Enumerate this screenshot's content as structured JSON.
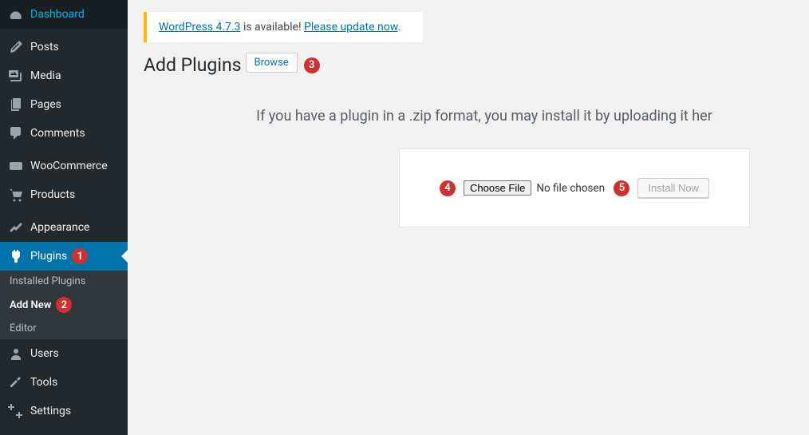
{
  "notice": {
    "version_link": "WordPress 4.7.3",
    "available_text": " is available! ",
    "update_link": "Please update now",
    "period": "."
  },
  "page": {
    "title": "Add Plugins",
    "browse_button": "Browse",
    "instructions": "If you have a plugin in a .zip format, you may install it by uploading it her",
    "choose_file": "Choose File",
    "no_file": "No file chosen",
    "install_now": "Install Now"
  },
  "badges": {
    "plugins": "1",
    "addnew": "2",
    "browse": "3",
    "choose": "4",
    "install": "5"
  },
  "sidebar": {
    "dashboard": "Dashboard",
    "posts": "Posts",
    "media": "Media",
    "pages": "Pages",
    "comments": "Comments",
    "woocommerce": "WooCommerce",
    "products": "Products",
    "appearance": "Appearance",
    "plugins": "Plugins",
    "installed_plugins": "Installed Plugins",
    "add_new": "Add New",
    "editor": "Editor",
    "users": "Users",
    "tools": "Tools",
    "settings": "Settings"
  }
}
